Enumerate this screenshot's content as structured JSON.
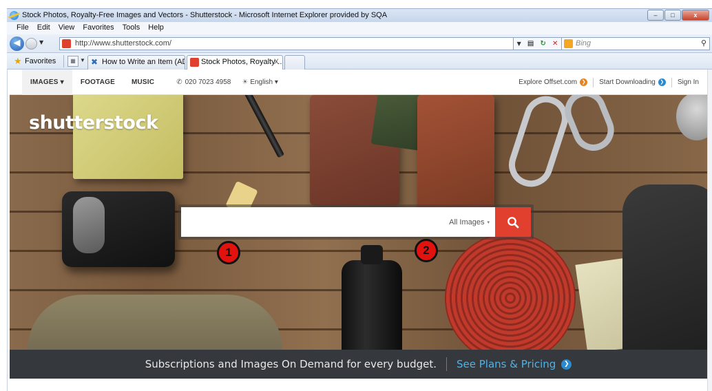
{
  "window": {
    "title": "Stock Photos, Royalty-Free Images and Vectors - Shutterstock - Microsoft Internet Explorer provided by SQA",
    "controls": {
      "minimize": "–",
      "maximize": "□",
      "close": "x"
    }
  },
  "menubar": {
    "items": [
      "File",
      "Edit",
      "View",
      "Favorites",
      "Tools",
      "Help"
    ]
  },
  "address": {
    "url": "http://www.shutterstock.com/",
    "search_placeholder": "Bing",
    "search_icon": "magnifier-icon",
    "tool_icons": [
      "dropdown-icon",
      "compatibility-icon",
      "refresh-icon",
      "stop-icon"
    ]
  },
  "favorites": {
    "label": "Favorites",
    "tabs": [
      {
        "label": "How to Write an Item (AD...",
        "active": false
      },
      {
        "label": "Stock Photos, Royalty-...",
        "active": true,
        "close": "X"
      }
    ]
  },
  "site_nav": {
    "left": [
      "IMAGES",
      "FOOTAGE",
      "MUSIC"
    ],
    "images_caret": "▾",
    "phone": "020 7023 4958",
    "language": "English",
    "language_caret": "▾",
    "right": [
      "Explore Offset.com",
      "Start Downloading",
      "Sign In"
    ]
  },
  "hero": {
    "logo": "shutterstock",
    "search": {
      "value": "",
      "placeholder": "",
      "type_label": "All Images",
      "type_caret": "▾",
      "button_icon": "search-icon",
      "button_color": "#e2402f"
    },
    "markers": [
      "1",
      "2"
    ]
  },
  "promo": {
    "text": "Subscriptions and Images On Demand for every budget.",
    "link": "See Plans & Pricing",
    "link_color": "#4fb3e8"
  },
  "colors": {
    "brand_red": "#e2402f",
    "nav_blue": "#2a8ad0",
    "nav_orange": "#e8821e",
    "promo_bg": "#35383c"
  }
}
